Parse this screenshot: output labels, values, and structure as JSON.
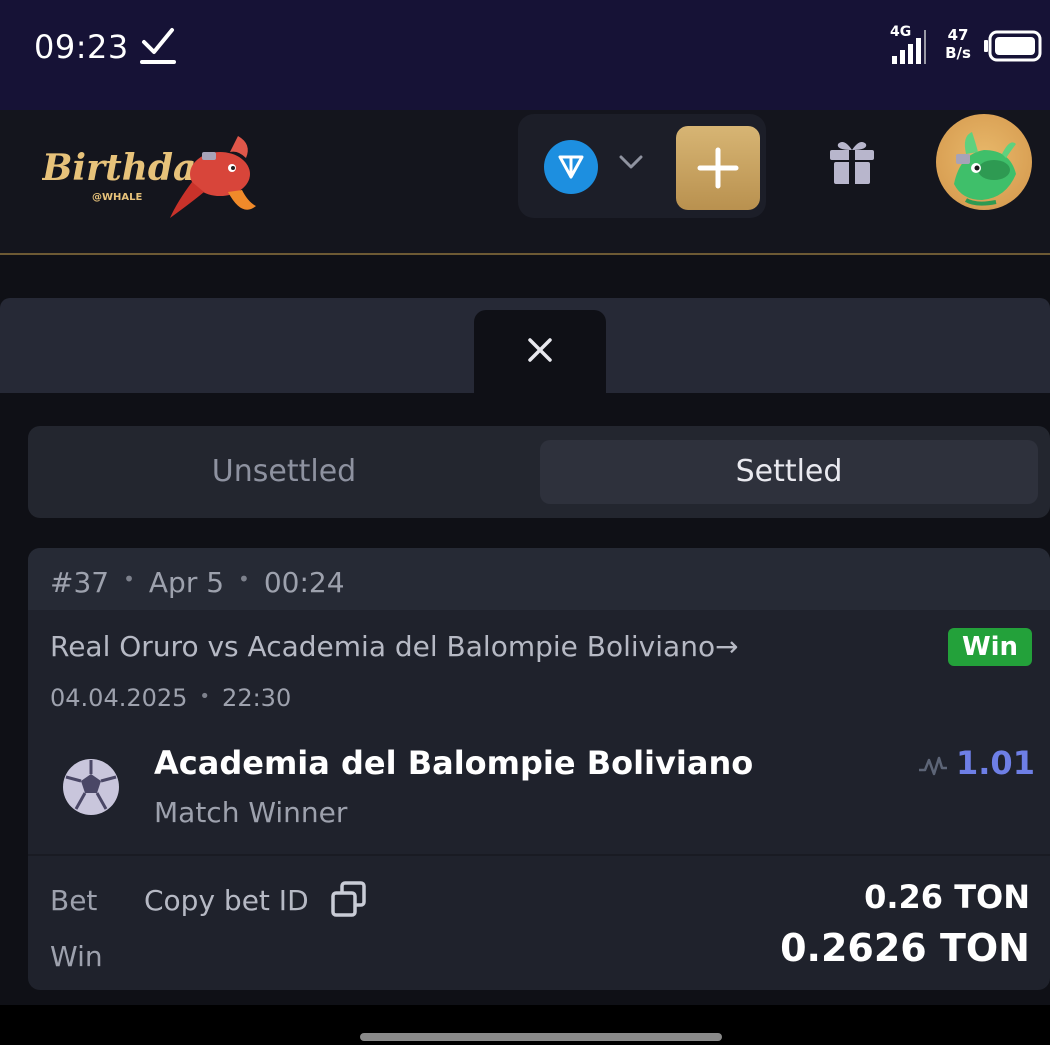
{
  "status_bar": {
    "time": "09:23",
    "network": "4G",
    "speed_value": "47",
    "speed_unit": "B/s",
    "icons": [
      "check-icon",
      "signal-icon",
      "battery-icon"
    ]
  },
  "header": {
    "logo_text": "Birthday",
    "logo_subtext": "@WHALE",
    "wallet_currency_icon": "ton-icon",
    "icons": [
      "chevron-down-icon",
      "plus-icon",
      "gift-icon",
      "avatar"
    ],
    "accent_color": "#c9a563"
  },
  "panel": {
    "close_icon": "close-icon"
  },
  "tabs": {
    "unsettled": "Unsettled",
    "settled": "Settled",
    "active": "Settled"
  },
  "bet": {
    "id": "#37",
    "date": "Apr 5",
    "time": "00:24",
    "match": "Real Oruro vs Academia del Balompie Boliviano",
    "match_arrow": "→",
    "status": "Win",
    "status_color": "#23a13a",
    "match_date": "04.04.2025",
    "match_time": "22:30",
    "selection": "Academia del Balompie Boliviano",
    "market": "Match Winner",
    "odds": "1.01",
    "odds_color": "#6e7fe6",
    "bet_label": "Bet",
    "copy_label": "Copy bet ID",
    "bet_amount": "0.26 TON",
    "win_label": "Win",
    "win_amount": "0.2626 TON"
  }
}
